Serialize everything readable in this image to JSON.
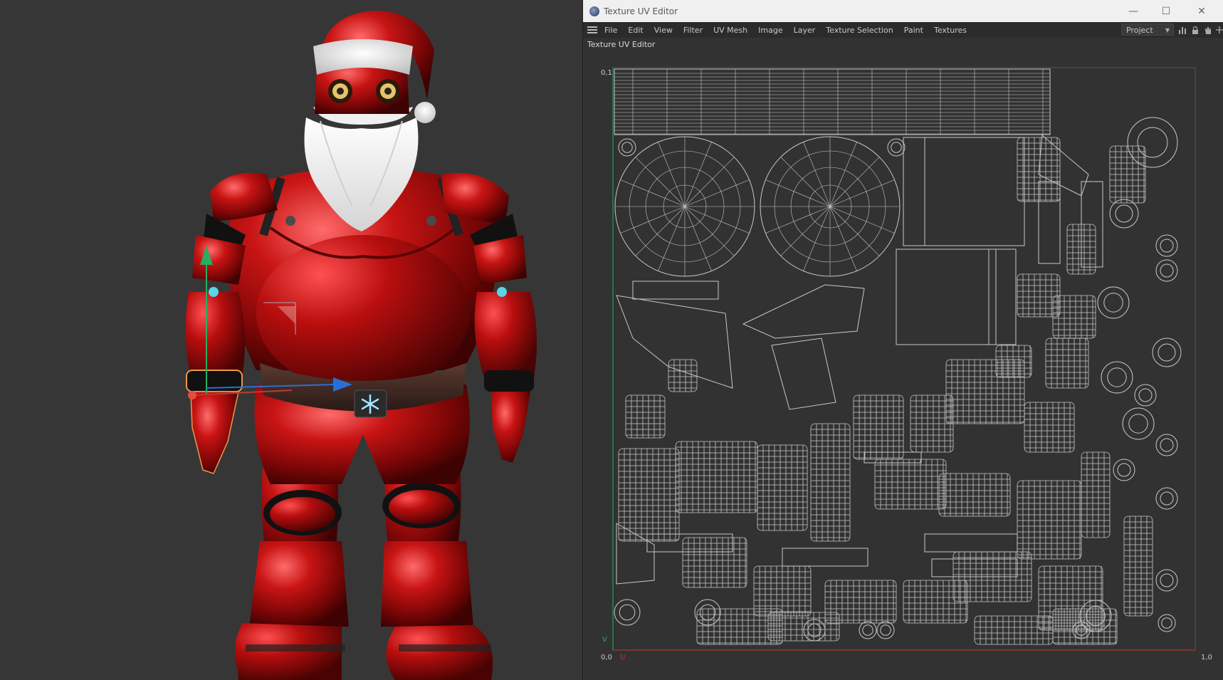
{
  "window": {
    "title": "Texture UV Editor",
    "minimize_glyph": "—",
    "maximize_glyph": "☐",
    "close_glyph": "✕"
  },
  "menu": {
    "items": [
      "File",
      "Edit",
      "View",
      "Filter",
      "UV Mesh",
      "Image",
      "Layer",
      "Texture Selection",
      "Paint",
      "Textures"
    ],
    "project_select": "Project"
  },
  "panel": {
    "title": "Texture UV Editor"
  },
  "uv_axes": {
    "top_left": "0,1",
    "origin": "0,0",
    "u_label": "U",
    "v_label": "V",
    "bottom_right": "1,0"
  },
  "icons": {
    "app": "cinema4d-icon",
    "snowflake": "snowflake-icon"
  },
  "colors": {
    "viewport_bg": "#363636",
    "uv_bg": "#323232",
    "uv_wire": "#c8c8c8",
    "axis_red": "#c0392b",
    "axis_green": "#27ae60",
    "robot_red": "#b01010"
  }
}
